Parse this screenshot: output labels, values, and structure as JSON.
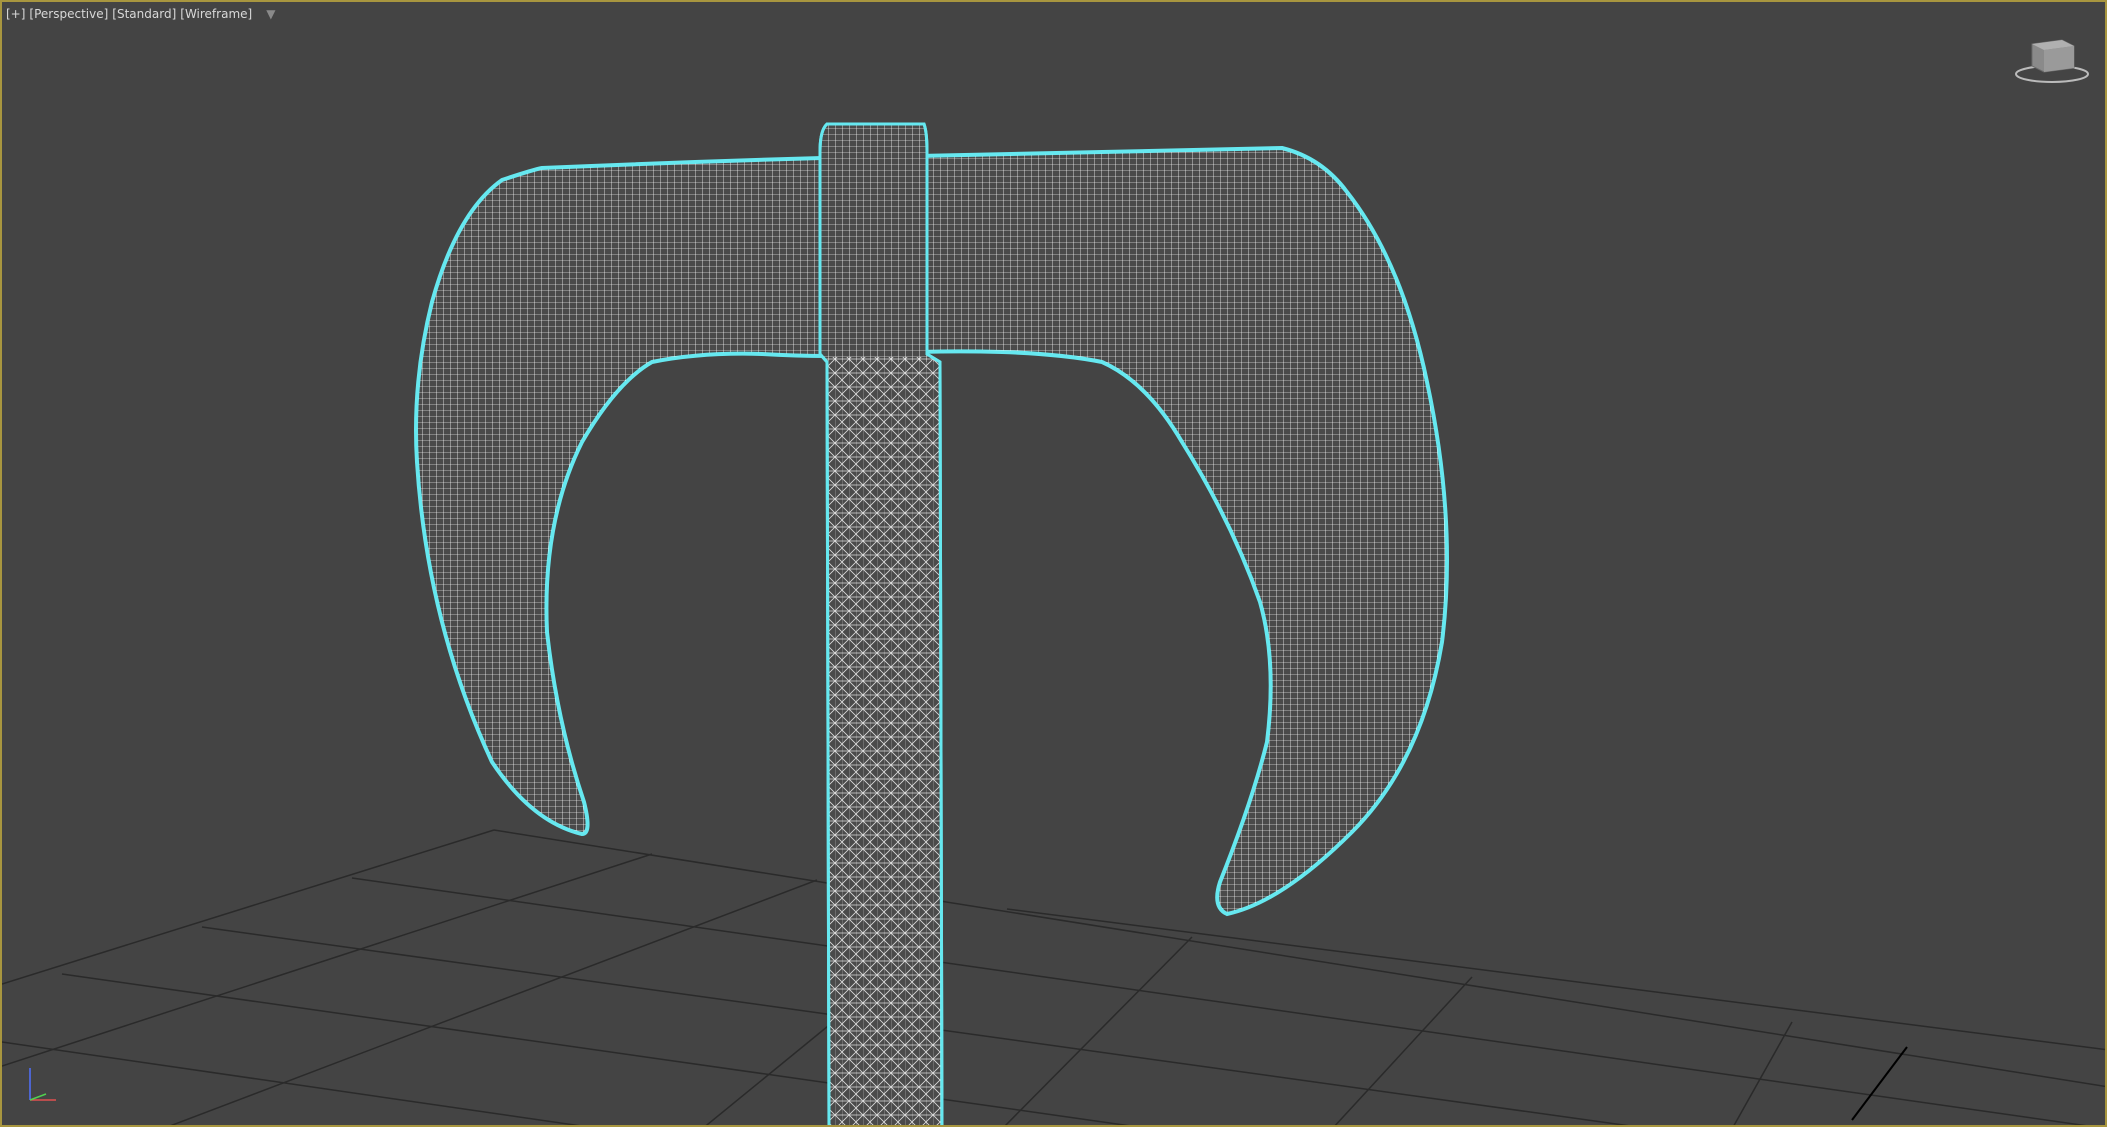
{
  "viewport": {
    "labels": [
      "[+]",
      "[Perspective]",
      "[Standard]",
      "[Wireframe]"
    ],
    "filter_icon": "funnel-icon",
    "active_border_color": "#a8963f",
    "background_color": "#444444",
    "grid_color": "#2a2a2a",
    "selection_color": "#66e8f0",
    "wire_color": "#ffffff"
  },
  "viewcube": {
    "icon": "viewcube-icon"
  },
  "axis_tripod": {
    "icon": "axis-tripod-icon",
    "x_color": "#e05050",
    "y_color": "#50d050",
    "z_color": "#5070ff"
  }
}
